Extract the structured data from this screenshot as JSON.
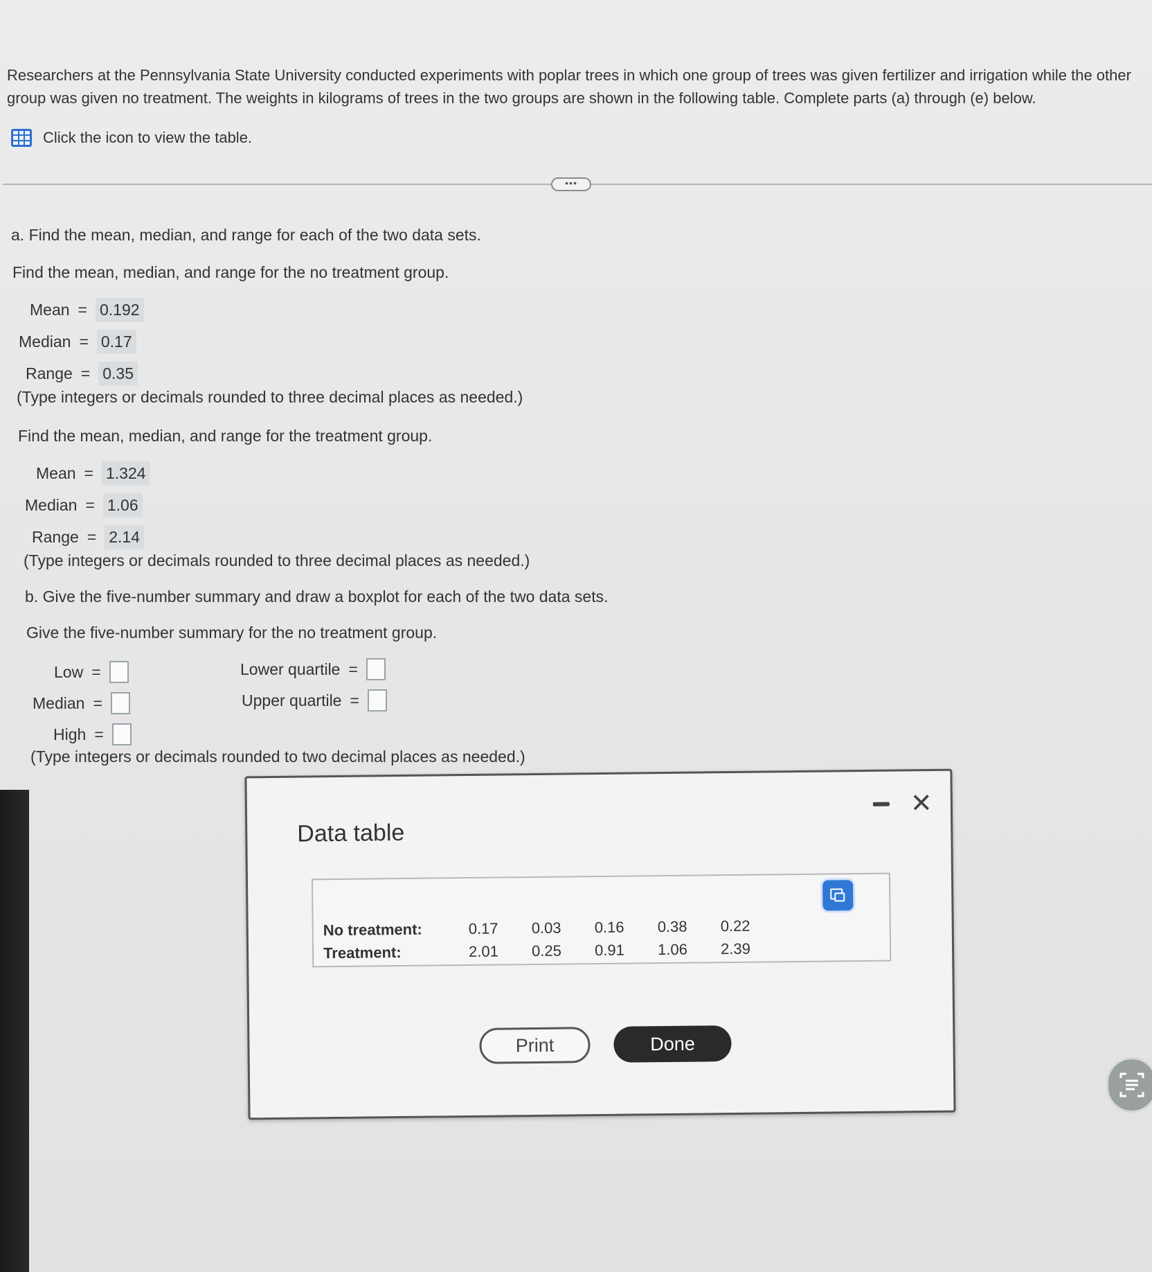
{
  "intro": {
    "text": "Researchers at the Pennsylvania State University conducted experiments with poplar trees in which one group of trees was given fertilizer and irrigation while the other group was given no treatment. The weights in kilograms of trees in the two groups are shown in the following table. Complete parts (a) through (e) below.",
    "table_link": "Click the icon to view the table."
  },
  "more_button": "•••",
  "part_a": {
    "heading": "a. Find the mean, median, and range for each of the two data sets.",
    "no_treatment": {
      "prompt": "Find the mean, median, and range for the no treatment group.",
      "mean_label": "Mean",
      "mean_value": "0.192",
      "median_label": "Median",
      "median_value": "0.17",
      "range_label": "Range",
      "range_value": "0.35",
      "note": "(Type integers or decimals rounded to three decimal places as needed.)"
    },
    "treatment": {
      "prompt": "Find the mean, median, and range for the treatment group.",
      "mean_label": "Mean",
      "mean_value": "1.324",
      "median_label": "Median",
      "median_value": "1.06",
      "range_label": "Range",
      "range_value": "2.14",
      "note": "(Type integers or decimals rounded to three decimal places as needed.)"
    }
  },
  "part_b": {
    "heading": "b. Give the five-number summary and draw a boxplot for each of the two data sets.",
    "prompt": "Give the five-number summary for the no treatment group.",
    "low_label": "Low",
    "median_label": "Median",
    "high_label": "High",
    "lower_quartile_label": "Lower quartile",
    "upper_quartile_label": "Upper quartile",
    "note": "(Type integers or decimals rounded to two decimal places as needed.)"
  },
  "eq": "=",
  "modal": {
    "title": "Data table",
    "rows": [
      {
        "label": "No treatment:",
        "values": [
          "0.17",
          "0.03",
          "0.16",
          "0.38",
          "0.22"
        ]
      },
      {
        "label": "Treatment:",
        "values": [
          "2.01",
          "0.25",
          "0.91",
          "1.06",
          "2.39"
        ]
      }
    ],
    "print_label": "Print",
    "done_label": "Done"
  }
}
